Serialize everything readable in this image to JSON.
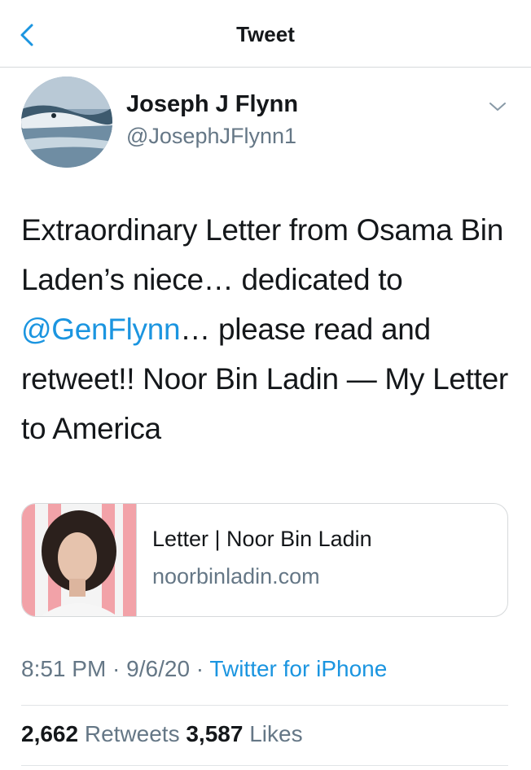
{
  "header": {
    "title": "Tweet",
    "back_icon": "chevron-left-icon"
  },
  "author": {
    "name": "Joseph J Flynn",
    "handle": "@JosephJFlynn1",
    "more_icon": "chevron-down-icon"
  },
  "tweet": {
    "text_part1": "Extraordinary Letter from Osama Bin Laden’s niece… dedicated to ",
    "mention": "@GenFlynn",
    "text_part2": "… please read and retweet!! Noor Bin Ladin — My Letter to America"
  },
  "link_card": {
    "title": "Letter | Noor Bin Ladin",
    "domain": "noorbinladin.com"
  },
  "meta": {
    "time": "8:51 PM",
    "separator": " · ",
    "date": "9/6/20",
    "source": "Twitter for iPhone"
  },
  "stats": {
    "retweets_count": "2,662",
    "retweets_label": "Retweets",
    "likes_count": "3,587",
    "likes_label": "Likes"
  },
  "colors": {
    "accent": "#1b95e0",
    "secondary_text": "#657786",
    "border": "#d6d9db"
  }
}
